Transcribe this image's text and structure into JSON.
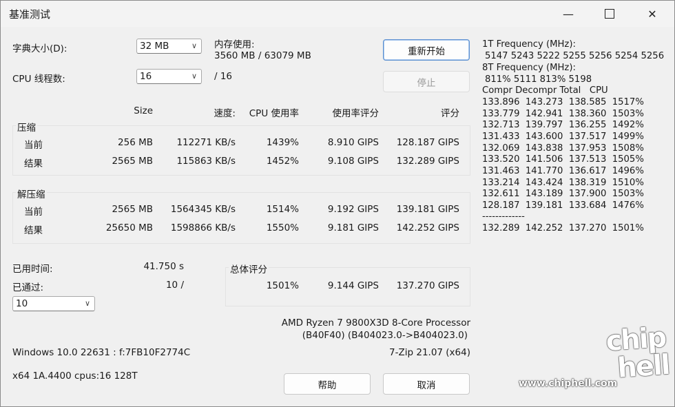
{
  "window": {
    "title": "基准测试"
  },
  "titlebar": {
    "min": "—",
    "close": "✕"
  },
  "dict": {
    "label": "字典大小(D):",
    "value": "32 MB"
  },
  "threads": {
    "label": "CPU 线程数:",
    "value": "16",
    "total": "/ 16"
  },
  "memory": {
    "label": "内存使用:",
    "value": "3560 MB / 63079 MB"
  },
  "buttons": {
    "restart": "重新开始",
    "stop": "停止",
    "help": "帮助",
    "cancel": "取消"
  },
  "headers": {
    "size": "Size",
    "speed": "速度:",
    "cpu": "CPU 使用率",
    "rating_usage": "使用率评分",
    "rating": "评分"
  },
  "compress": {
    "label": "压缩",
    "current": {
      "label": "当前",
      "size": "256 MB",
      "speed": "112271 KB/s",
      "cpu": "1439%",
      "rpu": "8.910 GIPS",
      "rating": "128.187 GIPS"
    },
    "result": {
      "label": "结果",
      "size": "2565 MB",
      "speed": "115863 KB/s",
      "cpu": "1452%",
      "rpu": "9.108 GIPS",
      "rating": "132.289 GIPS"
    }
  },
  "decompress": {
    "label": "解压缩",
    "current": {
      "label": "当前",
      "size": "2565 MB",
      "speed": "1564345 KB/s",
      "cpu": "1514%",
      "rpu": "9.192 GIPS",
      "rating": "139.181 GIPS"
    },
    "result": {
      "label": "结果",
      "size": "25650 MB",
      "speed": "1598866 KB/s",
      "cpu": "1550%",
      "rpu": "9.181 GIPS",
      "rating": "142.252 GIPS"
    }
  },
  "elapsed": {
    "label": "已用时间:",
    "value": "41.750 s"
  },
  "passes": {
    "label": "已通过:",
    "value": "10 /",
    "select": "10"
  },
  "total": {
    "label": "总体评分",
    "cpu": "1501%",
    "rpu": "9.144 GIPS",
    "rating": "137.270 GIPS"
  },
  "cpu_info": {
    "line1": "AMD Ryzen 7 9800X3D 8-Core Processor",
    "line2": "(B40F40) (B404023.0->B404023.0)"
  },
  "sys_info": {
    "os": "Windows 10.0 22631 :  f:7FB10F2774C",
    "arch": "x64 1A.4400 cpus:16 128T",
    "version": "7-Zip 21.07 (x64)"
  },
  "right_panel": {
    "f1_label": "1T Frequency (MHz):",
    "f1_values": "5147 5243 5222 5255 5256 5254 5256",
    "f8_label": "8T Frequency (MHz):",
    "f8_values": "811% 5111 813% 5198",
    "header": "Compr Decompr Total   CPU",
    "rows": [
      "133.896  143.273  138.585  1517%",
      "133.779  142.941  138.360  1503%",
      "132.713  139.797  136.255  1492%",
      "131.433  143.600  137.517  1499%",
      "132.069  143.838  137.953  1508%",
      "133.520  141.506  137.513  1505%",
      "131.463  141.770  136.617  1496%",
      "133.214  143.424  138.319  1510%",
      "132.611  143.189  137.900  1503%",
      "128.187  139.181  133.684  1476%"
    ],
    "separator": "-------------",
    "summary": "132.289  142.252  137.270  1501%"
  },
  "watermark": {
    "logo": "chip hell",
    "url": "www.chiphell.com"
  }
}
